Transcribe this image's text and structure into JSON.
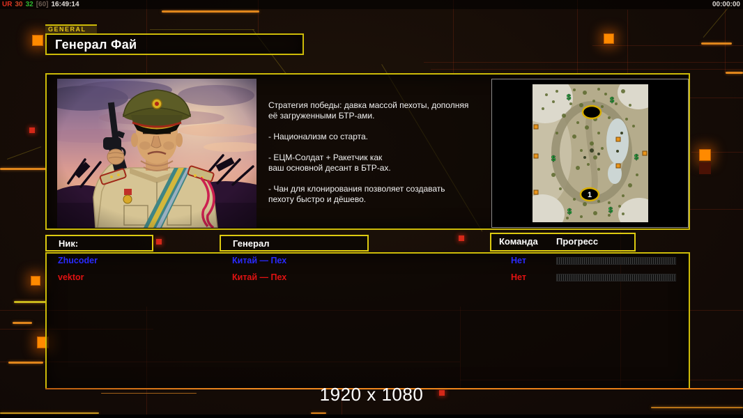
{
  "hud": {
    "debug": {
      "label": "UR",
      "fps": "30",
      "latency": "32",
      "cap": "[60]",
      "time": "16:49:14"
    },
    "match_time": "00:00:00"
  },
  "header": {
    "tab": "GENERAL",
    "title": "Генерал Фай"
  },
  "briefing": {
    "paragraphs": [
      "Стратегия победы: давка массой пехоты, дополняя\n её загруженными БТР-ами.",
      "- Национализм со старта.",
      "- ЕЦМ-Солдат + Ракетчик как\nваш основной десант в БТР-ах.",
      "- Чан для клонирования позволяет создавать\n пехоту быстро и дёшево."
    ]
  },
  "minimap": {
    "start_marker": "1",
    "supply_icon": "$"
  },
  "roster": {
    "headers": {
      "nick": "Ник:",
      "general": "Генерал",
      "team": "Команда",
      "progress": "Прогресс"
    },
    "players": [
      {
        "nick": "Zhucoder",
        "general": "Китай — Пех",
        "team": "Нет"
      },
      {
        "nick": "vektor",
        "general": "Китай — Пех",
        "team": "Нет"
      }
    ]
  },
  "footer": {
    "resolution": "1920 x 1080"
  },
  "colors": {
    "accent_yellow": "#cdbb08",
    "accent_orange": "#e8820a",
    "player_blue": "#2a2aff",
    "player_red": "#e01212"
  }
}
